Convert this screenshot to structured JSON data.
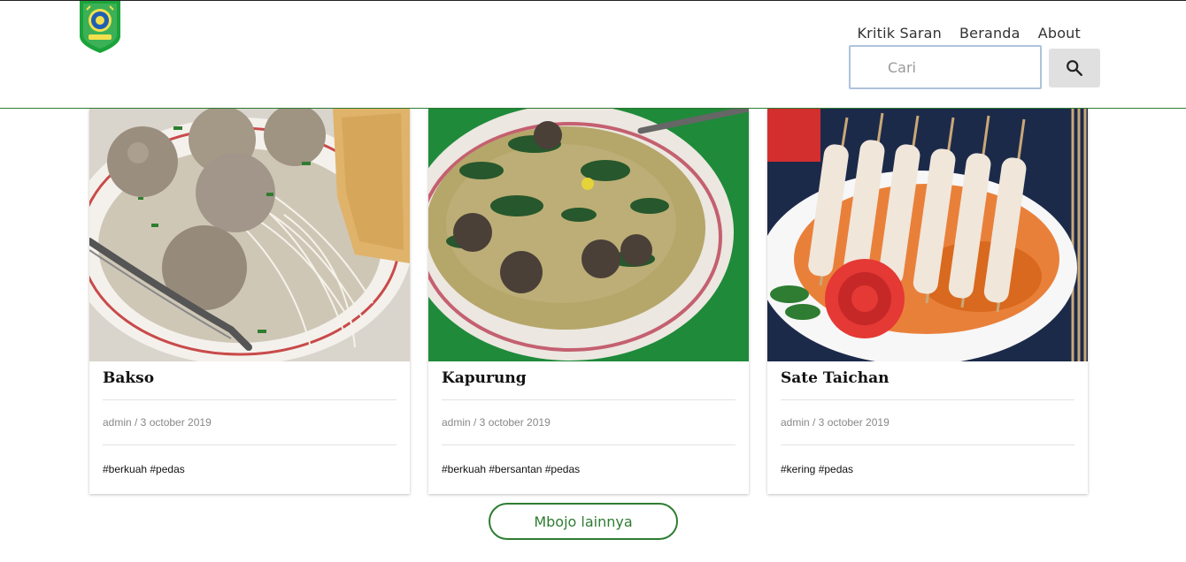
{
  "nav": {
    "items": [
      "Kritik Saran",
      "Beranda",
      "About"
    ]
  },
  "search": {
    "placeholder": "Cari",
    "value": ""
  },
  "cards": [
    {
      "title": "Bakso",
      "meta": "admin / 3 october 2019",
      "tags": "#berkuah #pedas"
    },
    {
      "title": "Kapurung",
      "meta": "admin / 3 october 2019",
      "tags": "#berkuah #bersantan #pedas"
    },
    {
      "title": "Sate Taichan",
      "meta": "admin / 3 october 2019",
      "tags": "#kering #pedas"
    }
  ],
  "more_button": {
    "label": "Mbojo lainnya"
  },
  "colors": {
    "accent_green": "#2e7d32",
    "logo_green": "#1aa33a",
    "search_border": "#aec3dd"
  },
  "icons": {
    "logo": "regional-emblem-icon",
    "search": "search-icon"
  }
}
